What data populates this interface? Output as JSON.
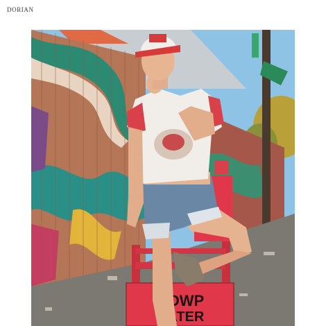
{
  "header": {
    "brand": "DORIAN"
  },
  "photo": {
    "sign_line_1": "L  DWP",
    "sign_line_2": "WATER"
  },
  "colors": {
    "sky": "#8fc3e6",
    "sign_red": "#e0384a",
    "cap_red": "#d63a3a",
    "denim": "#6b87a6",
    "pavement": "#7c7872"
  },
  "icons": {
    "street_sign": "street-sign-icon"
  }
}
